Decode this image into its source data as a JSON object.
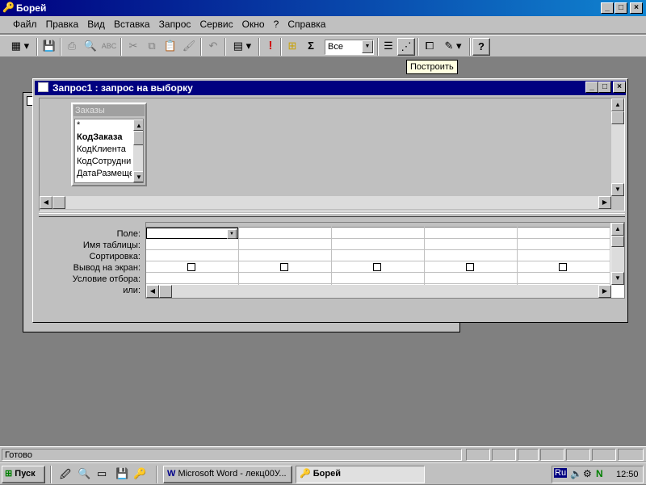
{
  "app": {
    "title": "Борей",
    "min": "_",
    "max": "□",
    "close": "×"
  },
  "menu": [
    {
      "label": "Файл"
    },
    {
      "label": "Правка"
    },
    {
      "label": "Вид"
    },
    {
      "label": "Вставка"
    },
    {
      "label": "Запрос"
    },
    {
      "label": "Сервис"
    },
    {
      "label": "Окно"
    },
    {
      "label": "?"
    },
    {
      "label": "Справка"
    }
  ],
  "toolbar": {
    "top_values_value": "Все",
    "tooltip": "Построить",
    "icons": [
      "view-icon",
      "save-icon",
      "print-icon",
      "print-preview-icon",
      "spelling-icon",
      "cut-icon",
      "copy-icon",
      "paste-icon",
      "format-painter-icon",
      "undo-icon",
      "query-type-icon",
      "run-icon",
      "show-table-icon",
      "totals-icon",
      "properties-icon",
      "build-icon",
      "database-window-icon",
      "new-object-icon",
      "help-icon"
    ]
  },
  "query_window": {
    "title": "Запрос1 : запрос на выборку",
    "table": {
      "name": "Заказы",
      "fields": [
        "*",
        "КодЗаказа",
        "КодКлиента",
        "КодСотрудни",
        "ДатаРазмеще"
      ]
    },
    "row_labels": [
      "Поле:",
      "Имя таблицы:",
      "Сортировка:",
      "Вывод на экран:",
      "Условие отбора:",
      "или:"
    ],
    "column_count": 5
  },
  "status": {
    "text": "Готово"
  },
  "taskbar": {
    "start": "Пуск",
    "tasks": [
      {
        "label": "Microsoft Word - лекц00У..."
      },
      {
        "label": "Борей"
      }
    ],
    "tray_lang": "Ru",
    "clock": "12:50"
  }
}
